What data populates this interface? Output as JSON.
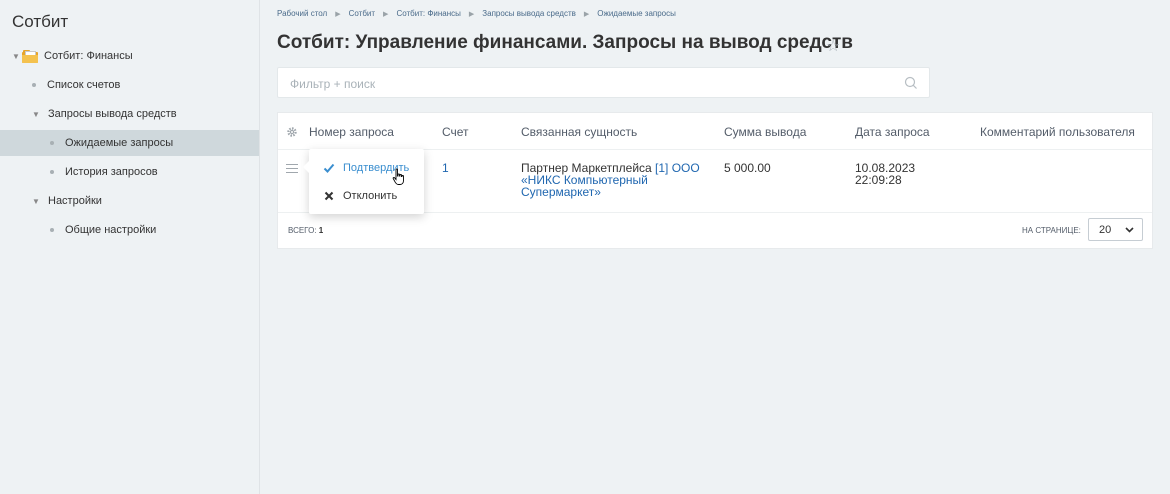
{
  "sidebar": {
    "title": "Сотбит",
    "items": [
      {
        "label": "Сотбит: Финансы"
      },
      {
        "label": "Список счетов"
      },
      {
        "label": "Запросы вывода средств"
      },
      {
        "label": "Ожидаемые запросы"
      },
      {
        "label": "История запросов"
      },
      {
        "label": "Настройки"
      },
      {
        "label": "Общие настройки"
      }
    ]
  },
  "breadcrumb": [
    "Рабочий стол",
    "Сотбит",
    "Сотбит: Финансы",
    "Запросы вывода средств",
    "Ожидаемые запросы"
  ],
  "page_title": "Сотбит: Управление финансами. Запросы на вывод средств",
  "search": {
    "placeholder": "Фильтр + поиск",
    "value": ""
  },
  "table": {
    "columns": [
      "Номер запроса",
      "Счет",
      "Связанная сущность",
      "Сумма вывода",
      "Дата запроса",
      "Комментарий пользователя"
    ],
    "rows": [
      {
        "account": "1",
        "entity_prefix": "Партнер Маркетплейса",
        "entity_link": "[1] ООО «НИКС Компьютерный Супермаркет»",
        "amount": "5 000.00",
        "date": "10.08.2023",
        "time": "22:09:28",
        "comment": ""
      }
    ],
    "total_label": "ВСЕГО:",
    "total_value": "1",
    "per_page_label": "НА СТРАНИЦЕ:",
    "per_page_value": "20"
  },
  "row_menu": {
    "items": [
      {
        "label": "Подтвердить",
        "icon": "check-icon"
      },
      {
        "label": "Отклонить",
        "icon": "close-icon"
      }
    ]
  },
  "colors": {
    "link": "#2067b0",
    "accent": "#3a8ecf",
    "sidebar_active": "#cfd8dc"
  }
}
